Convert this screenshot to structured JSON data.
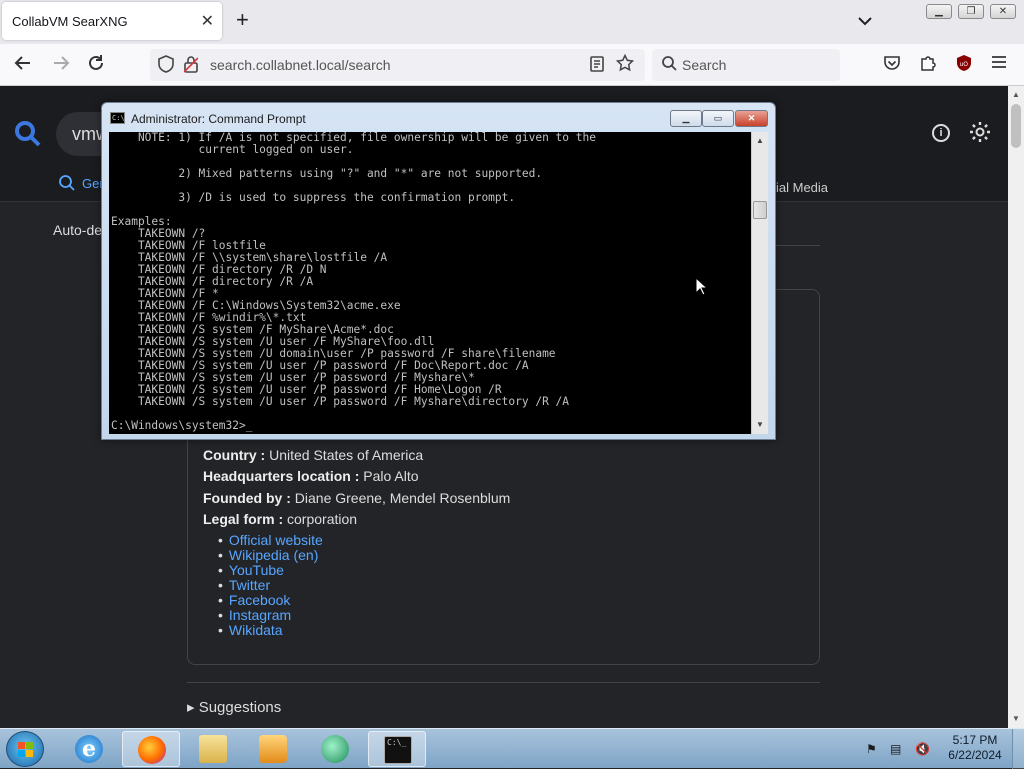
{
  "browser": {
    "tab_title": "CollabVM SearXNG",
    "tab_close": "✕",
    "new_tab": "+",
    "url": "search.collabnet.local/search",
    "search_placeholder": "Search"
  },
  "page": {
    "query_partial": "vmw",
    "category_general": "Gen",
    "category_social": "ial Media",
    "autodetect": "Auto-det",
    "facts": [
      {
        "label": "Country :",
        "value": "United States of America"
      },
      {
        "label": "Headquarters location :",
        "value": "Palo Alto"
      },
      {
        "label": "Founded by :",
        "value": "Diane Greene, Mendel Rosenblum"
      },
      {
        "label": "Legal form :",
        "value": "corporation"
      }
    ],
    "links": [
      "Official website",
      "Wikipedia (en)",
      "YouTube",
      "Twitter",
      "Facebook",
      "Instagram",
      "Wikidata"
    ],
    "suggestions": "▸ Suggestions"
  },
  "cmd": {
    "title": "Administrator: Command Prompt",
    "lines": [
      "    NOTE: 1) If /A is not specified, file ownership will be given to the",
      "             current logged on user.",
      "",
      "          2) Mixed patterns using \"?\" and \"*\" are not supported.",
      "",
      "          3) /D is used to suppress the confirmation prompt.",
      "",
      "Examples:",
      "    TAKEOWN /?",
      "    TAKEOWN /F lostfile",
      "    TAKEOWN /F \\\\system\\share\\lostfile /A",
      "    TAKEOWN /F directory /R /D N",
      "    TAKEOWN /F directory /R /A",
      "    TAKEOWN /F *",
      "    TAKEOWN /F C:\\Windows\\System32\\acme.exe",
      "    TAKEOWN /F %windir%\\*.txt",
      "    TAKEOWN /S system /F MyShare\\Acme*.doc",
      "    TAKEOWN /S system /U user /F MyShare\\foo.dll",
      "    TAKEOWN /S system /U domain\\user /P password /F share\\filename",
      "    TAKEOWN /S system /U user /P password /F Doc\\Report.doc /A",
      "    TAKEOWN /S system /U user /P password /F Myshare\\*",
      "    TAKEOWN /S system /U user /P password /F Home\\Logon /R",
      "    TAKEOWN /S system /U user /P password /F Myshare\\directory /R /A",
      "",
      "C:\\Windows\\system32>_"
    ]
  },
  "taskbar": {
    "time": "5:17 PM",
    "date": "6/22/2024",
    "items": [
      "ie-icon",
      "firefox-icon",
      "explorer-icon",
      "media-player-icon",
      "network-app-icon",
      "cmd-icon"
    ]
  },
  "colors": {
    "link": "#58a6ff",
    "page_bg": "#222428",
    "console_fg": "#c0c0c0"
  }
}
